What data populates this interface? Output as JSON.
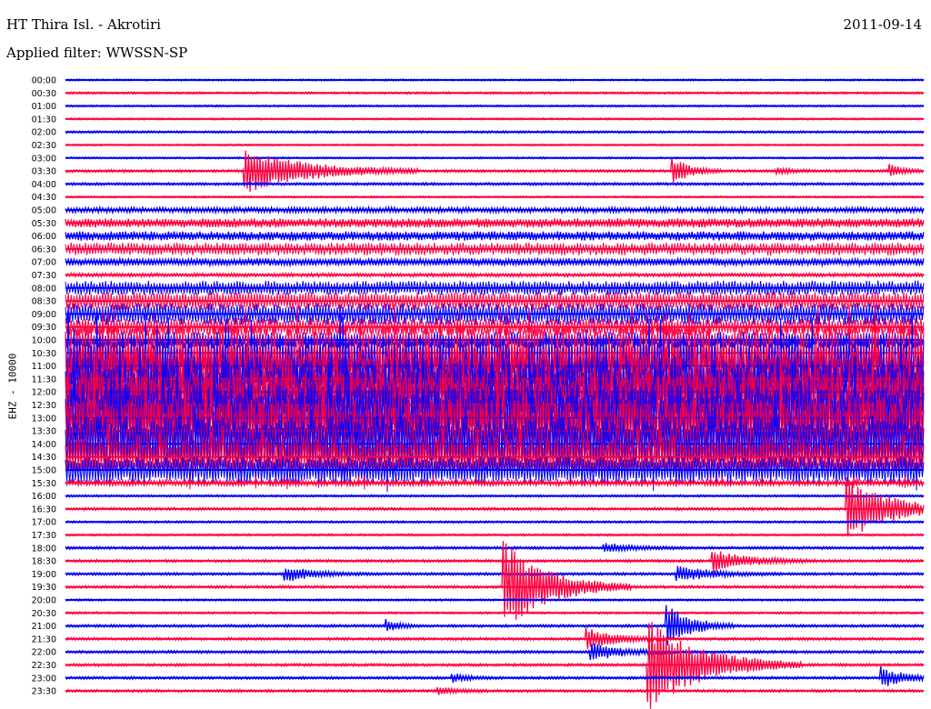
{
  "header": {
    "station": "HT Thira Isl. - Akrotiri",
    "date": "2011-09-14",
    "filter": "Applied filter: WWSSN-SP"
  },
  "chart_data": {
    "type": "helicorder",
    "title": "HT Thira Isl. - Akrotiri",
    "ylabel": "EHZ - 10000",
    "row_minutes": 30,
    "colors": [
      "#0000ff",
      "#ff0040"
    ],
    "rows": [
      "00:00",
      "00:30",
      "01:00",
      "01:30",
      "02:00",
      "02:30",
      "03:00",
      "03:30",
      "04:00",
      "04:30",
      "05:00",
      "05:30",
      "06:00",
      "06:30",
      "07:00",
      "07:30",
      "08:00",
      "08:30",
      "09:00",
      "09:30",
      "10:00",
      "10:30",
      "11:00",
      "11:30",
      "12:00",
      "12:30",
      "13:00",
      "13:30",
      "14:00",
      "14:30",
      "15:00",
      "15:30",
      "16:00",
      "16:30",
      "17:00",
      "17:30",
      "18:00",
      "18:30",
      "19:00",
      "19:30",
      "20:00",
      "20:30",
      "21:00",
      "21:30",
      "22:00",
      "22:30",
      "23:00",
      "23:30"
    ],
    "noise_level": [
      1,
      1.2,
      1,
      1,
      1.2,
      1,
      1,
      1.5,
      1.5,
      1,
      3,
      5,
      5,
      7,
      4,
      2,
      8,
      10,
      12,
      10,
      9,
      30,
      35,
      38,
      40,
      40,
      38,
      35,
      30,
      20,
      15,
      3,
      1.2,
      1.5,
      1.2,
      1.2,
      1.5,
      1.5,
      1.5,
      1.5,
      1.2,
      1.2,
      1.5,
      1.5,
      1.5,
      1.5,
      1.5,
      1.5
    ],
    "events": [
      {
        "row": "03:30",
        "minute": 6.3,
        "amplitude": 25,
        "duration": 2.0
      },
      {
        "row": "03:30",
        "minute": 21.2,
        "amplitude": 15,
        "duration": 0.6
      },
      {
        "row": "03:30",
        "minute": 24.9,
        "amplitude": 3,
        "duration": 0.5
      },
      {
        "row": "03:30",
        "minute": 28.8,
        "amplitude": 8,
        "duration": 0.4
      },
      {
        "row": "16:30",
        "minute": 27.3,
        "amplitude": 35,
        "duration": 1.5
      },
      {
        "row": "18:00",
        "minute": 18.8,
        "amplitude": 5,
        "duration": 1.0
      },
      {
        "row": "18:30",
        "minute": 22.6,
        "amplitude": 12,
        "duration": 1.2
      },
      {
        "row": "19:00",
        "minute": 7.7,
        "amplitude": 8,
        "duration": 1.0
      },
      {
        "row": "19:00",
        "minute": 21.4,
        "amplitude": 8,
        "duration": 1.2
      },
      {
        "row": "19:30",
        "minute": 15.3,
        "amplitude": 50,
        "duration": 1.5
      },
      {
        "row": "21:00",
        "minute": 21.0,
        "amplitude": 25,
        "duration": 0.8
      },
      {
        "row": "21:00",
        "minute": 11.2,
        "amplitude": 8,
        "duration": 0.4
      },
      {
        "row": "21:30",
        "minute": 18.2,
        "amplitude": 12,
        "duration": 1.0
      },
      {
        "row": "22:00",
        "minute": 18.4,
        "amplitude": 10,
        "duration": 1.0
      },
      {
        "row": "22:30",
        "minute": 20.4,
        "amplitude": 50,
        "duration": 1.8
      },
      {
        "row": "23:00",
        "minute": 28.5,
        "amplitude": 12,
        "duration": 0.8
      },
      {
        "row": "23:00",
        "minute": 13.5,
        "amplitude": 5,
        "duration": 0.5
      },
      {
        "row": "23:30",
        "minute": 13.0,
        "amplitude": 4,
        "duration": 0.6
      }
    ]
  }
}
